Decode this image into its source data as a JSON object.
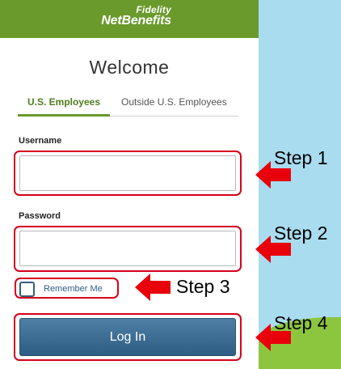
{
  "brand": {
    "name_top": "Fidelity",
    "name_bottom": "NetBenefits",
    "header_color": "#6a9a2c"
  },
  "login": {
    "title": "Welcome",
    "tabs": [
      {
        "label": "U.S. Employees",
        "active": true
      },
      {
        "label": "Outside U.S. Employees",
        "active": false
      }
    ],
    "username": {
      "label": "Username",
      "value": "",
      "placeholder": ""
    },
    "password": {
      "label": "Password",
      "value": "",
      "placeholder": ""
    },
    "remember_me": {
      "label": "Remember Me",
      "checked": false
    },
    "submit_label": "Log In",
    "button_color": "#3a6b93"
  },
  "annotations": {
    "steps": [
      {
        "label": "Step 1"
      },
      {
        "label": "Step 2"
      },
      {
        "label": "Step 3"
      },
      {
        "label": "Step 4"
      }
    ],
    "highlight_color": "#d6001c",
    "arrow_color": "#e8000b"
  }
}
